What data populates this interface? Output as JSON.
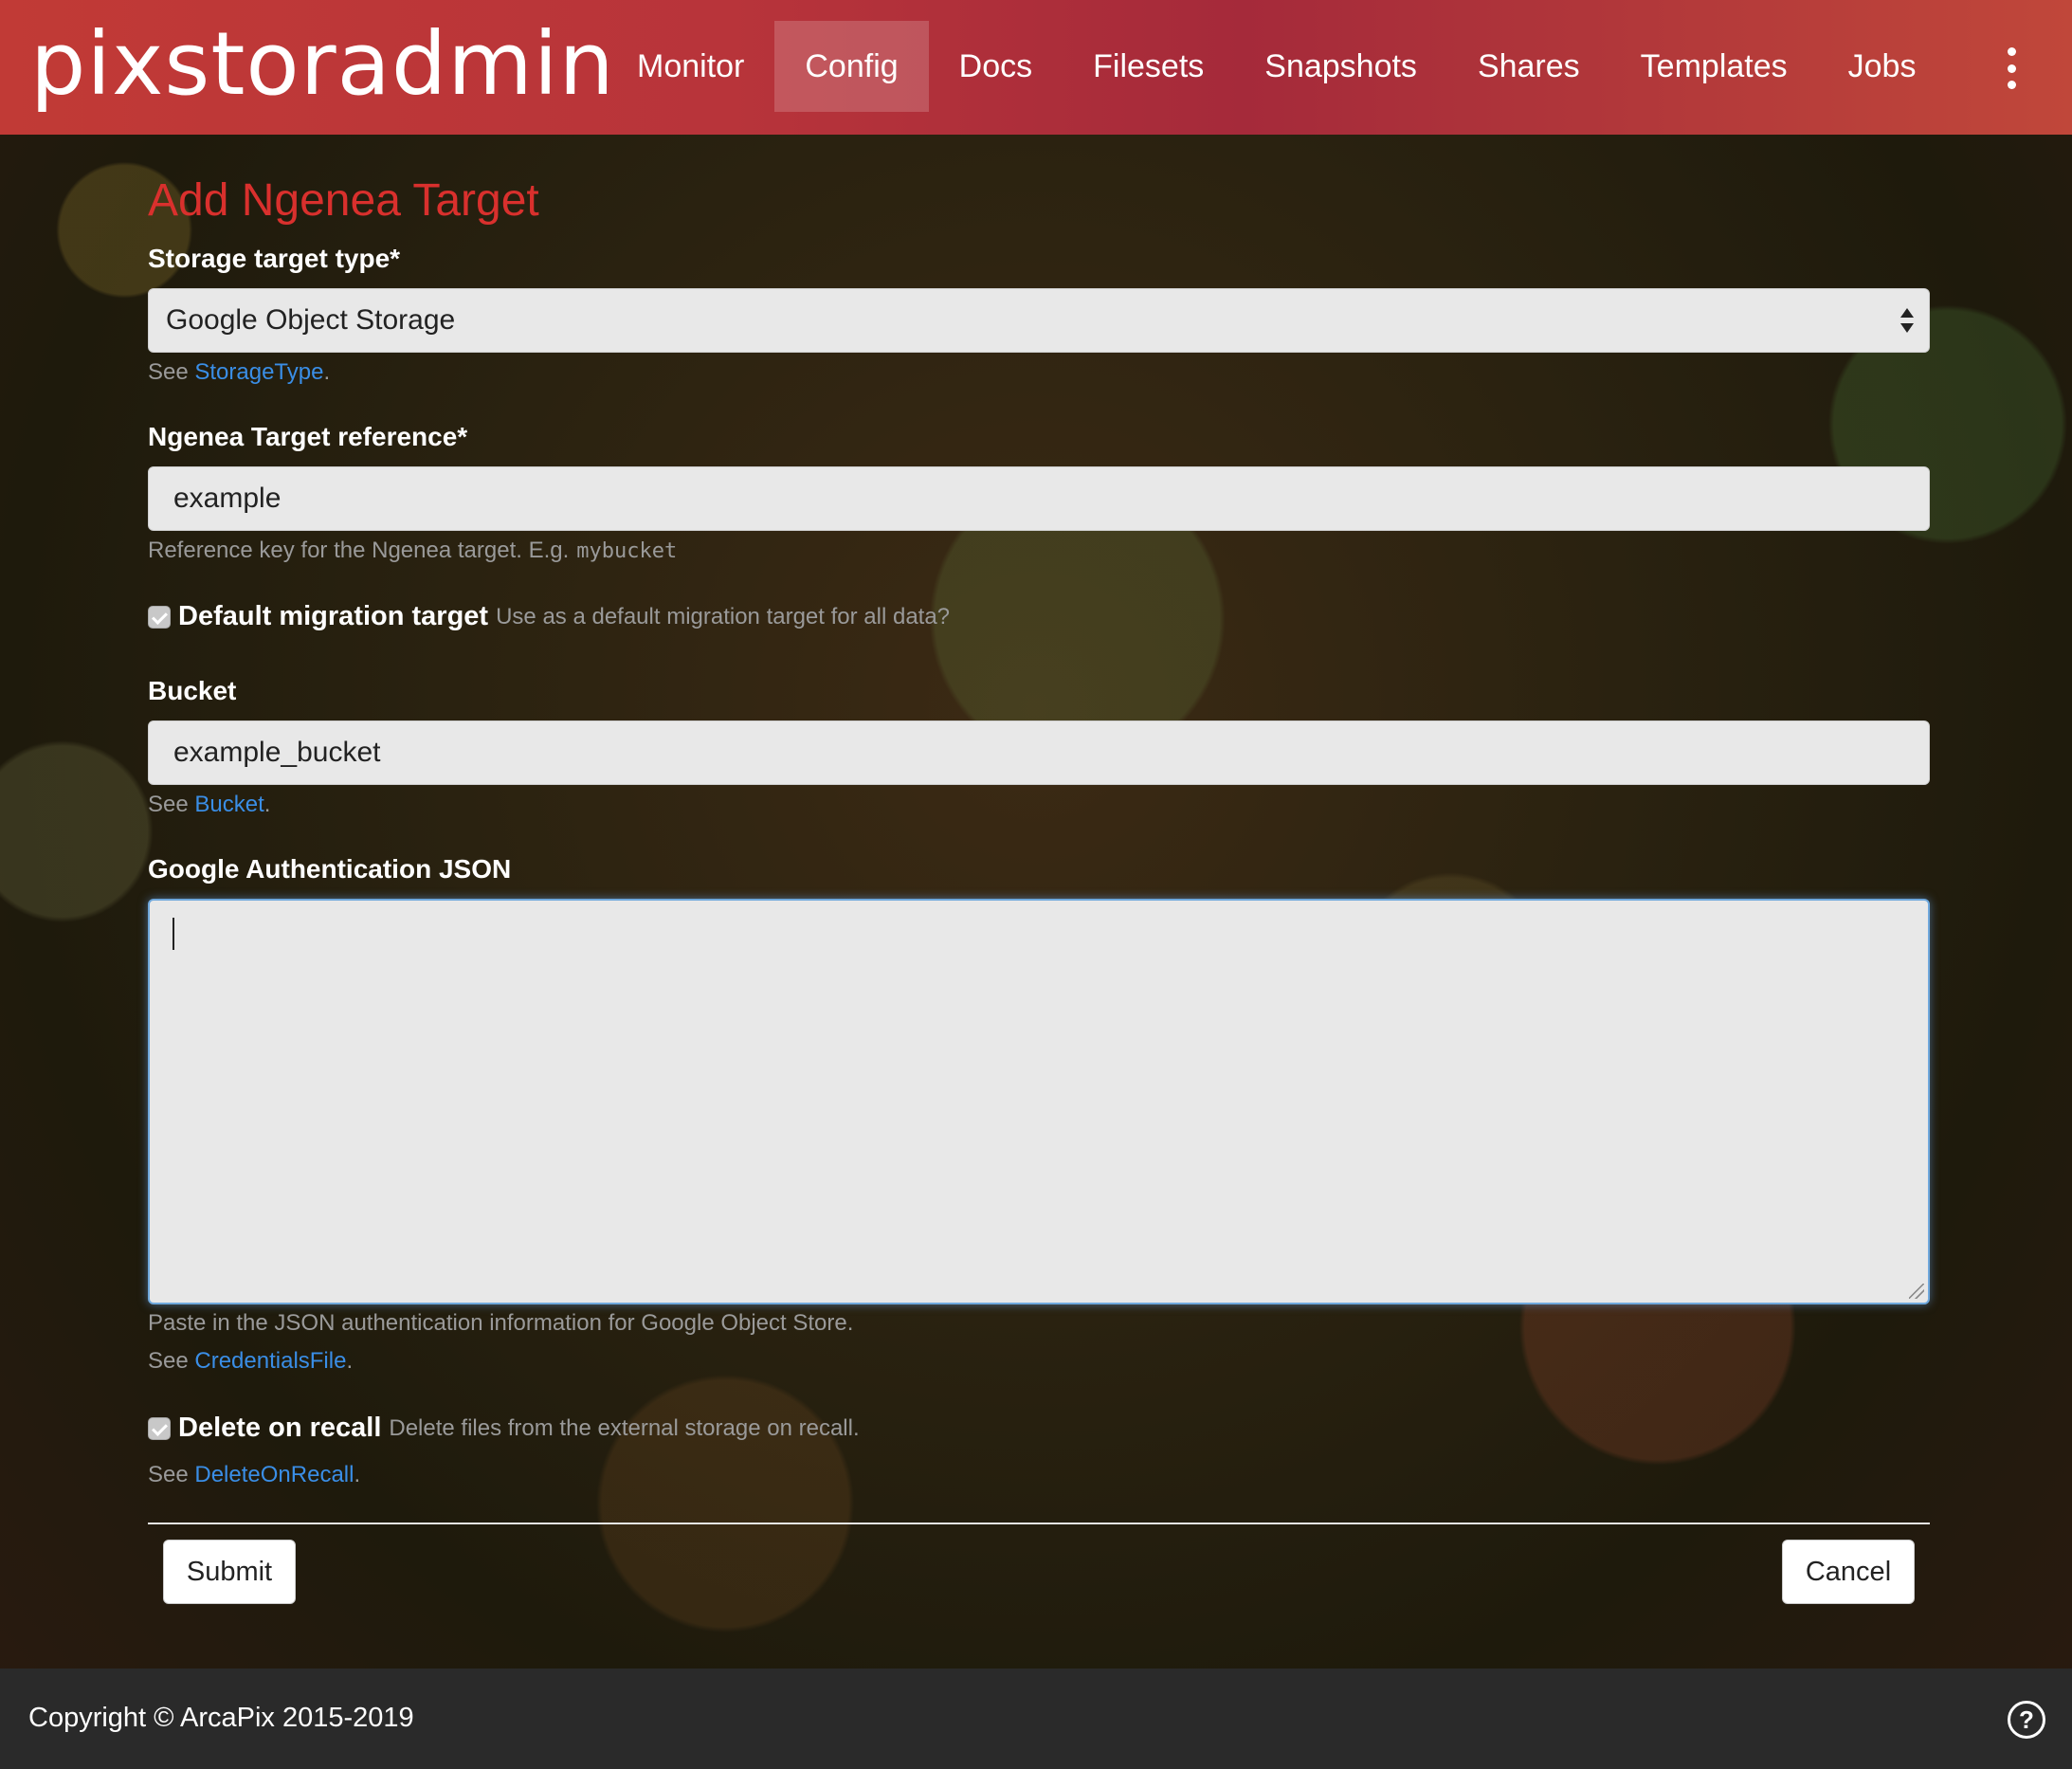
{
  "app": {
    "brand": "pixstoradmin"
  },
  "nav": {
    "items": [
      {
        "label": "Monitor",
        "active": false
      },
      {
        "label": "Config",
        "active": true
      },
      {
        "label": "Docs",
        "active": false
      },
      {
        "label": "Filesets",
        "active": false
      },
      {
        "label": "Snapshots",
        "active": false
      },
      {
        "label": "Shares",
        "active": false
      },
      {
        "label": "Templates",
        "active": false
      },
      {
        "label": "Jobs",
        "active": false
      }
    ],
    "more_icon": "kebab-menu-icon"
  },
  "form": {
    "title": "Add Ngenea Target",
    "storage_type": {
      "label": "Storage target type*",
      "selected": "Google Object Storage",
      "help_prefix": "See ",
      "help_link": "StorageType",
      "help_suffix": "."
    },
    "target_reference": {
      "label": "Ngenea Target reference*",
      "value": "example",
      "help": "Reference key for the Ngenea target. E.g.",
      "help_example": "mybucket"
    },
    "default_migration": {
      "checked": true,
      "label": "Default migration target",
      "description": "Use as a default migration target for all data?"
    },
    "bucket": {
      "label": "Bucket",
      "value": "example_bucket",
      "help_prefix": "See ",
      "help_link": "Bucket",
      "help_suffix": "."
    },
    "google_auth": {
      "label": "Google Authentication JSON",
      "value": "",
      "help": "Paste in the JSON authentication information for Google Object Store.",
      "help2_prefix": "See ",
      "help2_link": "CredentialsFile",
      "help2_suffix": "."
    },
    "delete_on_recall": {
      "checked": true,
      "label": "Delete on recall",
      "description": "Delete files from the external storage on recall.",
      "help_prefix": "See ",
      "help_link": "DeleteOnRecall",
      "help_suffix": "."
    },
    "submit_label": "Submit",
    "cancel_label": "Cancel"
  },
  "footer": {
    "copyright": "Copyright © ArcaPix 2015-2019",
    "help_icon": "question-circle-icon"
  },
  "colors": {
    "header_red": "#b8343a",
    "title_red": "#d9302d",
    "link_blue": "#3a8ee6",
    "footer_bg": "#2a2a2a"
  }
}
